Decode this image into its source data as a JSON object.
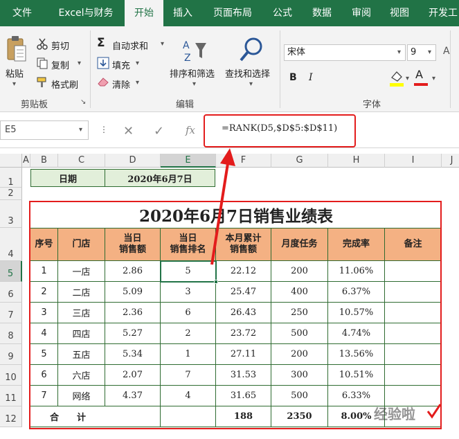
{
  "tabs": [
    {
      "label": "文件"
    },
    {
      "label": "Excel与财务"
    },
    {
      "label": "开始"
    },
    {
      "label": "插入"
    },
    {
      "label": "页面布局"
    },
    {
      "label": "公式"
    },
    {
      "label": "数据"
    },
    {
      "label": "审阅"
    },
    {
      "label": "视图"
    },
    {
      "label": "开发工"
    }
  ],
  "ribbon": {
    "clipboard": {
      "paste": "粘贴",
      "cut": "剪切",
      "copy": "复制",
      "format_painter": "格式刷",
      "group_label": "剪贴板"
    },
    "editing": {
      "autosum": "自动求和",
      "fill": "填充",
      "clear": "清除",
      "sort_filter": "排序和筛选",
      "find_select": "查找和选择",
      "group_label": "编辑"
    },
    "font": {
      "font_name": "宋体",
      "font_size": "9",
      "bold": "B",
      "italic": "I",
      "font_color_letter": "A",
      "group_label": "字体"
    }
  },
  "formula_bar": {
    "name_box": "E5",
    "fx": "fx",
    "formula": "=RANK(D5,$D$5:$D$11)"
  },
  "columns": [
    "A",
    "B",
    "C",
    "D",
    "E",
    "F",
    "G",
    "H",
    "I",
    "J"
  ],
  "rows": [
    "1",
    "2",
    "3",
    "4",
    "5",
    "6",
    "7",
    "8",
    "9",
    "10",
    "11",
    "12"
  ],
  "date_label": "日期",
  "date_value": "2020年6月7日",
  "sheet_title": "2020年6月7日销售业绩表",
  "headers": [
    [
      "序号"
    ],
    [
      "门店"
    ],
    [
      "当日",
      "销售额"
    ],
    [
      "当日",
      "销售排名"
    ],
    [
      "本月累计",
      "销售额"
    ],
    [
      "月度任务"
    ],
    [
      "完成率"
    ],
    [
      "备注"
    ]
  ],
  "table_rows": [
    [
      "1",
      "一店",
      "2.86",
      "5",
      "22.12",
      "200",
      "11.06%",
      ""
    ],
    [
      "2",
      "二店",
      "5.09",
      "3",
      "25.47",
      "400",
      "6.37%",
      ""
    ],
    [
      "3",
      "三店",
      "2.36",
      "6",
      "26.43",
      "250",
      "10.57%",
      ""
    ],
    [
      "4",
      "四店",
      "5.27",
      "2",
      "23.72",
      "500",
      "4.74%",
      ""
    ],
    [
      "5",
      "五店",
      "5.34",
      "1",
      "27.11",
      "200",
      "13.56%",
      ""
    ],
    [
      "6",
      "六店",
      "2.07",
      "7",
      "31.53",
      "300",
      "10.51%",
      ""
    ],
    [
      "7",
      "网络",
      "4.37",
      "4",
      "31.65",
      "500",
      "6.33%",
      ""
    ]
  ],
  "total_row": {
    "label": "合　　计",
    "month_total": "188",
    "task_total": "2350",
    "rate": "8.00%"
  },
  "watermark": "经验啦",
  "colors": {
    "ribbon_green": "#217346",
    "header_fill": "#f4b183",
    "date_fill": "#e2efda",
    "highlight": "#e31c1c"
  }
}
